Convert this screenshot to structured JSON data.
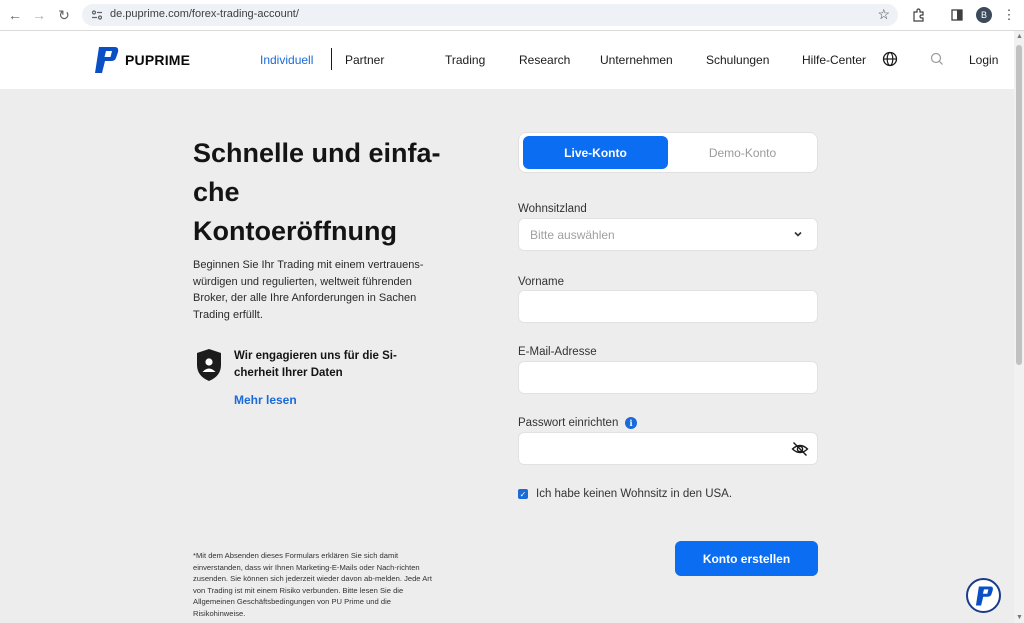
{
  "browser": {
    "url": "de.puprime.com/forex-trading-account/",
    "profile_initial": "B"
  },
  "header": {
    "brand": "PUPRIME",
    "nav": {
      "individual": "Individuell",
      "partner": "Partner",
      "trading": "Trading",
      "research": "Research",
      "company": "Unternehmen",
      "training": "Schulungen",
      "help": "Hilfe-Center",
      "login": "Login"
    }
  },
  "hero": {
    "title_line1": "Schnelle und einfa-",
    "title_line2": "che",
    "title_line3": "Kontoeröffnung",
    "description": "Beginnen Sie Ihr Trading mit einem vertrauens-würdigen und regulierten, weltweit führenden Broker, der alle Ihre Anforderungen in Sachen Trading erfüllt.",
    "security_text": "Wir engagieren uns für die Si-cherheit Ihrer Daten",
    "more_link": "Mehr lesen",
    "disclaimer": "*Mit dem Absenden dieses Formulars erklären Sie sich damit einverstanden, dass wir Ihnen Marketing-E-Mails oder Nach-richten zusenden. Sie können sich jederzeit wieder davon ab-melden. Jede Art von Trading ist mit einem Risiko verbunden. Bitte lesen Sie die Allgemeinen Geschäftsbedingungen von PU Prime und die Risikohinweise."
  },
  "form": {
    "tab_live": "Live-Konto",
    "tab_demo": "Demo-Konto",
    "country_label": "Wohnsitzland",
    "country_placeholder": "Bitte auswählen",
    "firstname_label": "Vorname",
    "email_label": "E-Mail-Adresse",
    "password_label": "Passwort einrichten",
    "us_checkbox_label": "Ich habe keinen Wohnsitz in den USA.",
    "us_checkbox_checked": true,
    "submit_label": "Konto erstellen"
  },
  "colors": {
    "accent": "#0a6df2",
    "link": "#1a6ad8",
    "page_bg": "#ededed"
  },
  "icons": [
    "back-icon",
    "forward-icon",
    "reload-icon",
    "site-info-icon",
    "star-icon",
    "extensions-icon",
    "sidepanel-icon",
    "menu-icon",
    "globe-icon",
    "search-icon",
    "shield-user-icon",
    "chevron-down-icon",
    "eye-off-icon",
    "info-icon",
    "chat-logo-icon"
  ]
}
